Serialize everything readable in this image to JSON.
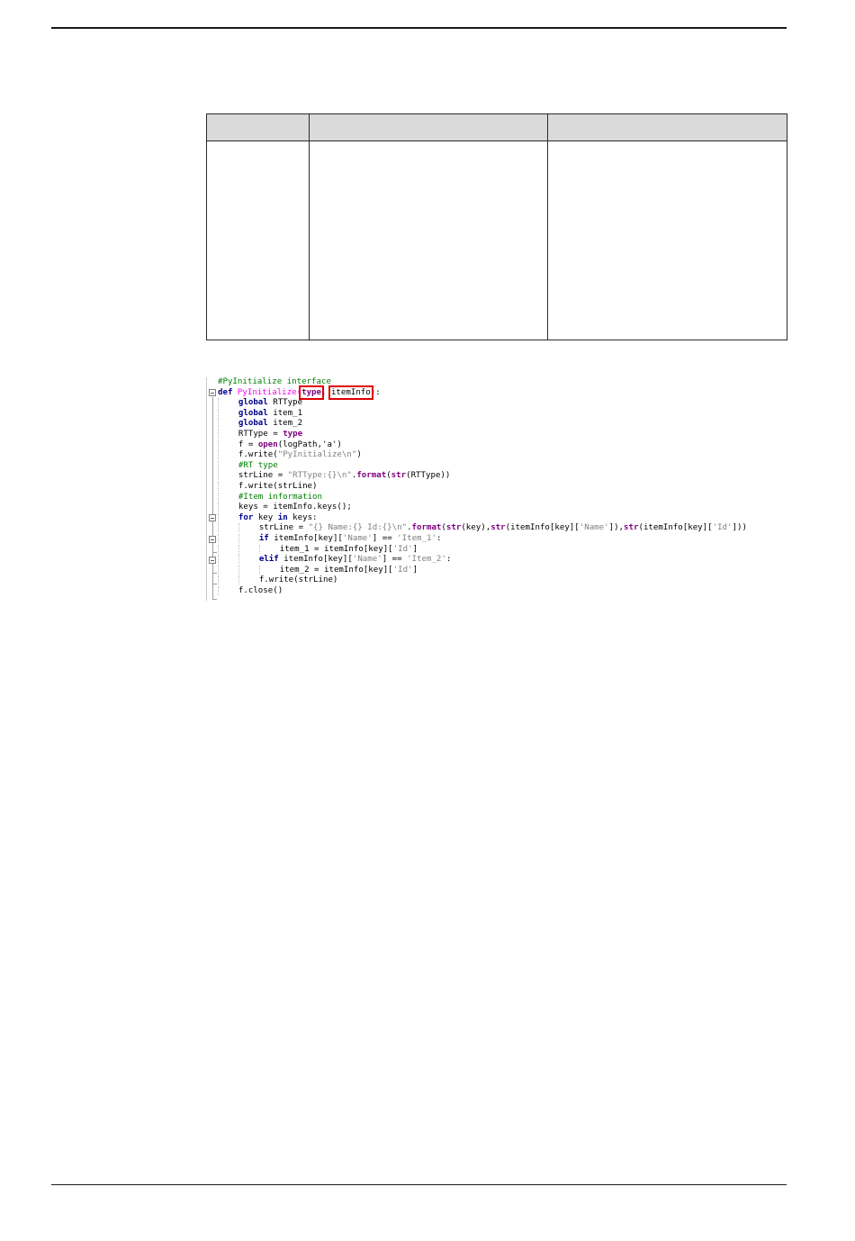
{
  "table": {
    "headers": [
      "",
      "",
      ""
    ],
    "rows": [
      [
        "",
        "",
        ""
      ]
    ]
  },
  "code": {
    "lines": [
      {
        "indent": 0,
        "tokens": [
          {
            "t": "#PyInitialize interface",
            "c": "cm"
          }
        ]
      },
      {
        "indent": 0,
        "tokens": [
          {
            "t": "def ",
            "c": "kw"
          },
          {
            "t": "PyInitialize(",
            "c": "fn"
          },
          {
            "t": "type",
            "c": "bi",
            "hl": true
          },
          {
            "t": ", "
          },
          {
            "t": "itemInfo",
            "hl": true
          },
          {
            "t": "):"
          }
        ]
      },
      {
        "indent": 1,
        "tokens": [
          {
            "t": "global ",
            "c": "kw"
          },
          {
            "t": "RTType"
          }
        ]
      },
      {
        "indent": 1,
        "tokens": [
          {
            "t": "global ",
            "c": "kw"
          },
          {
            "t": "item_1"
          }
        ]
      },
      {
        "indent": 1,
        "tokens": [
          {
            "t": "global ",
            "c": "kw"
          },
          {
            "t": "item_2"
          }
        ]
      },
      {
        "indent": 1,
        "tokens": [
          {
            "t": "RTType = "
          },
          {
            "t": "type",
            "c": "bi"
          }
        ]
      },
      {
        "indent": 1,
        "tokens": [
          {
            "t": "f = "
          },
          {
            "t": "open",
            "c": "bi"
          },
          {
            "t": "(logPath,'a')"
          }
        ]
      },
      {
        "indent": 1,
        "tokens": [
          {
            "t": "f.write("
          },
          {
            "t": "\"PyInitialize\\n\"",
            "c": "st"
          },
          {
            "t": ")"
          }
        ]
      },
      {
        "indent": 1,
        "tokens": [
          {
            "t": "#RT type",
            "c": "cm"
          }
        ]
      },
      {
        "indent": 1,
        "tokens": [
          {
            "t": "strLine = "
          },
          {
            "t": "\"RTType:{}\\n\"",
            "c": "st"
          },
          {
            "t": "."
          },
          {
            "t": "format",
            "c": "bi"
          },
          {
            "t": "("
          },
          {
            "t": "str",
            "c": "bi"
          },
          {
            "t": "(RTType))"
          }
        ]
      },
      {
        "indent": 1,
        "tokens": [
          {
            "t": "f.write(strLine)"
          }
        ]
      },
      {
        "indent": 1,
        "tokens": [
          {
            "t": "#Item information",
            "c": "cm"
          }
        ]
      },
      {
        "indent": 1,
        "tokens": [
          {
            "t": "keys = itemInfo.keys();"
          }
        ]
      },
      {
        "indent": 1,
        "tokens": [
          {
            "t": "for ",
            "c": "kw"
          },
          {
            "t": "key "
          },
          {
            "t": "in ",
            "c": "kw"
          },
          {
            "t": "keys:"
          }
        ]
      },
      {
        "indent": 2,
        "tokens": [
          {
            "t": "strLine = "
          },
          {
            "t": "\"{} Name:{} Id:{}\\n\"",
            "c": "st"
          },
          {
            "t": "."
          },
          {
            "t": "format",
            "c": "bi"
          },
          {
            "t": "("
          },
          {
            "t": "str",
            "c": "bi"
          },
          {
            "t": "(key),"
          },
          {
            "t": "str",
            "c": "bi"
          },
          {
            "t": "(itemInfo[key]["
          },
          {
            "t": "'Name'",
            "c": "st"
          },
          {
            "t": "]),"
          },
          {
            "t": "str",
            "c": "bi"
          },
          {
            "t": "(itemInfo[key]["
          },
          {
            "t": "'Id'",
            "c": "st"
          },
          {
            "t": "]))"
          }
        ]
      },
      {
        "indent": 2,
        "tokens": [
          {
            "t": "if ",
            "c": "kw"
          },
          {
            "t": "itemInfo[key]["
          },
          {
            "t": "'Name'",
            "c": "st"
          },
          {
            "t": "] == "
          },
          {
            "t": "'Item_1'",
            "c": "st"
          },
          {
            "t": ":"
          }
        ]
      },
      {
        "indent": 3,
        "tokens": [
          {
            "t": "item_1 = itemInfo[key]["
          },
          {
            "t": "'Id'",
            "c": "st"
          },
          {
            "t": "]"
          }
        ]
      },
      {
        "indent": 2,
        "tokens": [
          {
            "t": "elif ",
            "c": "kw"
          },
          {
            "t": "itemInfo[key]["
          },
          {
            "t": "'Name'",
            "c": "st"
          },
          {
            "t": "] == "
          },
          {
            "t": "'Item_2'",
            "c": "st"
          },
          {
            "t": ":"
          }
        ]
      },
      {
        "indent": 3,
        "tokens": [
          {
            "t": "item_2 = itemInfo[key]["
          },
          {
            "t": "'Id'",
            "c": "st"
          },
          {
            "t": "]"
          }
        ]
      },
      {
        "indent": 2,
        "tokens": [
          {
            "t": "f.write(strLine)"
          }
        ]
      },
      {
        "indent": 1,
        "tokens": [
          {
            "t": "f.close()"
          }
        ]
      }
    ]
  }
}
